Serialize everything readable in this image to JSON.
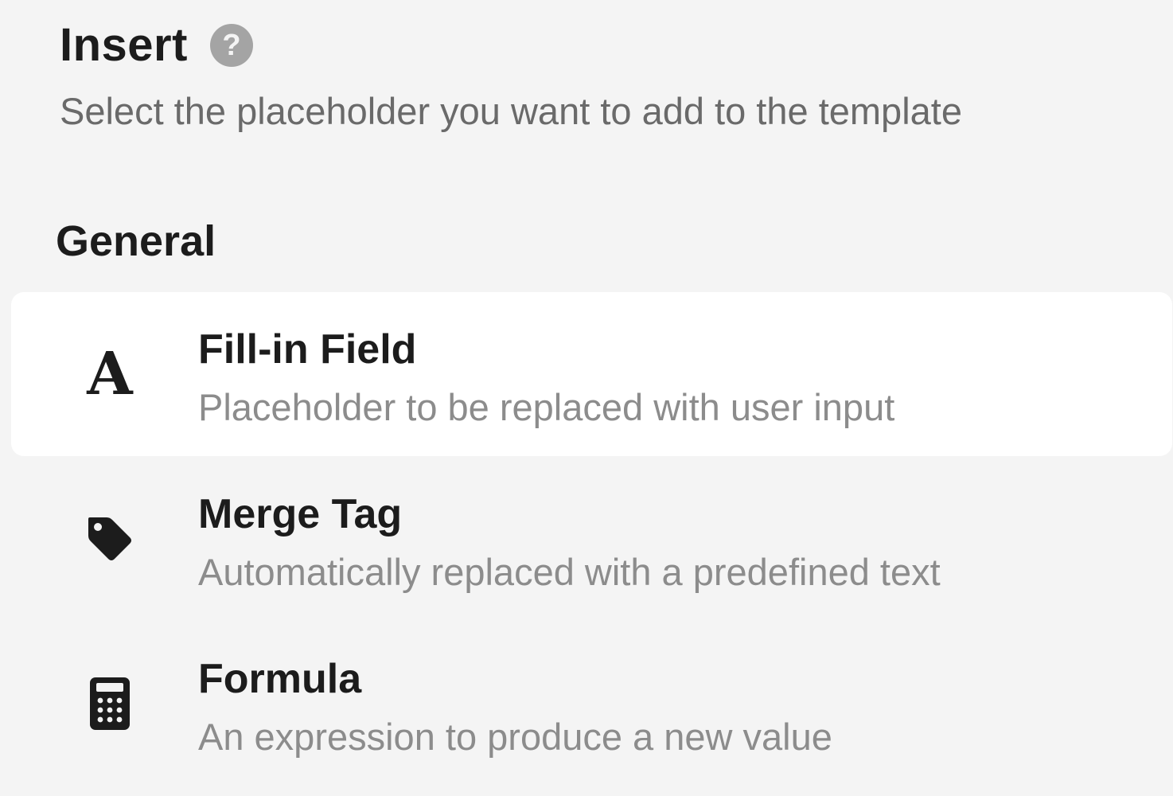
{
  "header": {
    "title": "Insert",
    "help_glyph": "?",
    "subtitle": "Select the placeholder you want to add to the template"
  },
  "section": {
    "title": "General"
  },
  "items": [
    {
      "label": "Fill-in Field",
      "description": "Placeholder to be replaced with user input",
      "icon": "font-letter-a-icon",
      "icon_glyph": "A",
      "selected": true
    },
    {
      "label": "Merge Tag",
      "description": "Automatically replaced with a predefined text",
      "icon": "tag-icon",
      "selected": false
    },
    {
      "label": "Formula",
      "description": "An expression to produce a new value",
      "icon": "calculator-icon",
      "selected": false
    }
  ],
  "colors": {
    "background": "#f4f4f4",
    "selected_background": "#ffffff",
    "title_text": "#1c1c1c",
    "secondary_text": "#6a6a6a",
    "description_text": "#8c8c8c",
    "help_icon": "#a4a4a4"
  }
}
